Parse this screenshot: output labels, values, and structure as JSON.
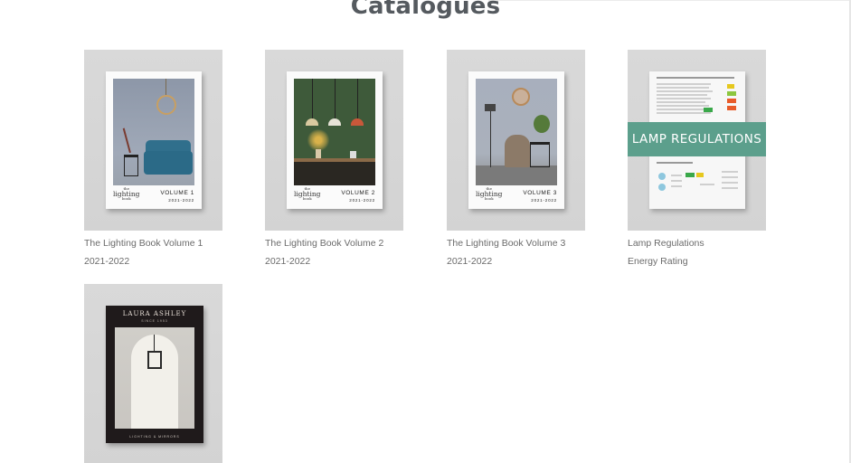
{
  "page": {
    "title": "Catalogues"
  },
  "catalogues": [
    {
      "title": "The Lighting Book Volume 1",
      "subtitle": "2021-2022",
      "cover": {
        "brand_top": "the",
        "brand_main": "lighting",
        "brand_bottom": "book",
        "volume": "VOLUME 1",
        "years": "2021-2022"
      }
    },
    {
      "title": "The Lighting Book Volume 2",
      "subtitle": "2021-2022",
      "cover": {
        "brand_top": "the",
        "brand_main": "lighting",
        "brand_bottom": "book",
        "volume": "VOLUME 2",
        "years": "2021-2022"
      }
    },
    {
      "title": "The Lighting Book Volume 3",
      "subtitle": "2021-2022",
      "cover": {
        "brand_top": "the",
        "brand_main": "lighting",
        "brand_bottom": "book",
        "volume": "VOLUME 3",
        "years": "2021-2022"
      }
    },
    {
      "title": "Lamp Regulations",
      "subtitle": "Energy Rating",
      "cover": {
        "banner": "LAMP REGULATIONS"
      }
    },
    {
      "title": "",
      "subtitle": "",
      "cover": {
        "brand": "LAURA ASHLEY",
        "since": "SINCE 1953",
        "footer": "LIGHTING & MIRRORS"
      }
    }
  ],
  "colors": {
    "title": "#555a5f",
    "card_text": "#6b6b6b",
    "thumb_bg": "#d6d6d6",
    "regulations_banner": "#5c9f8c",
    "laura_ashley_cover": "#1f1a1b"
  }
}
